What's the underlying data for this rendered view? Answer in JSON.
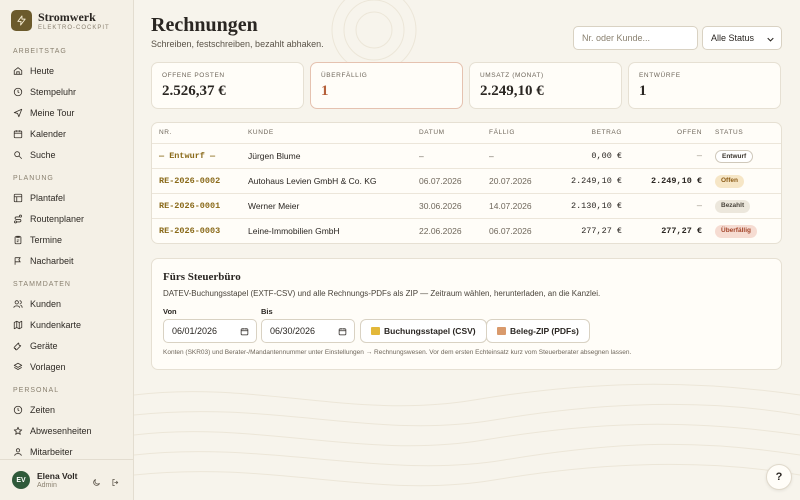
{
  "brand": {
    "name": "Stromwerk",
    "subtitle": "ELEKTRO-COCKPIT"
  },
  "sidebar": {
    "sections": [
      {
        "label": "ARBEITSTAG",
        "items": [
          {
            "label": "Heute",
            "icon": "home-icon"
          },
          {
            "label": "Stempeluhr",
            "icon": "clock-icon"
          },
          {
            "label": "Meine Tour",
            "icon": "send-icon"
          },
          {
            "label": "Kalender",
            "icon": "calendar-icon"
          },
          {
            "label": "Suche",
            "icon": "search-icon"
          }
        ]
      },
      {
        "label": "PLANUNG",
        "items": [
          {
            "label": "Plantafel",
            "icon": "grid-icon"
          },
          {
            "label": "Routenplaner",
            "icon": "route-icon"
          },
          {
            "label": "Termine",
            "icon": "clipboard-icon"
          },
          {
            "label": "Nacharbeit",
            "icon": "flag-icon"
          }
        ]
      },
      {
        "label": "STAMMDATEN",
        "items": [
          {
            "label": "Kunden",
            "icon": "users-icon"
          },
          {
            "label": "Kundenkarte",
            "icon": "map-icon"
          },
          {
            "label": "Geräte",
            "icon": "tool-icon"
          },
          {
            "label": "Vorlagen",
            "icon": "layers-icon"
          }
        ]
      },
      {
        "label": "PERSONAL",
        "items": [
          {
            "label": "Zeiten",
            "icon": "clock-icon"
          },
          {
            "label": "Abwesenheiten",
            "icon": "star-icon"
          },
          {
            "label": "Mitarbeiter",
            "icon": "user-icon"
          }
        ]
      }
    ]
  },
  "user": {
    "initials": "EV",
    "name": "Elena Volt",
    "role": "Admin"
  },
  "page": {
    "title": "Rechnungen",
    "subtitle": "Schreiben, festschreiben, bezahlt abhaken."
  },
  "search": {
    "placeholder": "Nr. oder Kunde..."
  },
  "status_filter": {
    "selected": "Alle Status"
  },
  "cards": [
    {
      "label": "OFFENE POSTEN",
      "value": "2.526,37 €"
    },
    {
      "label": "ÜBERFÄLLIG",
      "value": "1"
    },
    {
      "label": "UMSATZ (MONAT)",
      "value": "2.249,10 €"
    },
    {
      "label": "ENTWÜRFE",
      "value": "1"
    }
  ],
  "table": {
    "headers": {
      "nr": "NR.",
      "kunde": "KUNDE",
      "datum": "DATUM",
      "faellig": "FÄLLIG",
      "betrag": "BETRAG",
      "offen": "OFFEN",
      "status": "STATUS"
    },
    "rows": [
      {
        "nr": "— Entwurf —",
        "kunde": "Jürgen Blume",
        "datum": "–",
        "faellig": "–",
        "betrag": "0,00 €",
        "offen": "—",
        "status": "Entwurf"
      },
      {
        "nr": "RE-2026-0002",
        "kunde": "Autohaus Levien GmbH & Co. KG",
        "datum": "06.07.2026",
        "faellig": "20.07.2026",
        "betrag": "2.249,10 €",
        "offen": "2.249,10 €",
        "status": "Offen"
      },
      {
        "nr": "RE-2026-0001",
        "kunde": "Werner Meier",
        "datum": "30.06.2026",
        "faellig": "14.07.2026",
        "betrag": "2.130,10 €",
        "offen": "—",
        "status": "Bezahlt"
      },
      {
        "nr": "RE-2026-0003",
        "kunde": "Leine-Immobilien GmbH",
        "datum": "22.06.2026",
        "faellig": "06.07.2026",
        "betrag": "277,27 €",
        "offen": "277,27 €",
        "status": "Überfällig"
      }
    ]
  },
  "tax": {
    "title": "Fürs Steuerbüro",
    "description": "DATEV-Buchungsstapel (EXTF-CSV) und alle Rechnungs-PDFs als ZIP — Zeitraum wählen, herunterladen, an die Kanzlei.",
    "from_label": "Von",
    "from_value": "06/01/2026",
    "to_label": "Bis",
    "to_value": "06/30/2026",
    "csv_button": "Buchungsstapel (CSV)",
    "zip_button": "Beleg-ZIP (PDFs)",
    "note": "Konten (SKR03) und Berater-/Mandantennummer unter Einstellungen → Rechnungswesen. Vor dem ersten Echteinsatz kurz vom Steuerberater absegnen lassen."
  },
  "help": {
    "label": "?"
  },
  "colors": {
    "accent": "#6b5a2c",
    "invoice_number": "#8a6a1a",
    "overdue": "#b5603a",
    "avatar": "#2f5a3a"
  }
}
